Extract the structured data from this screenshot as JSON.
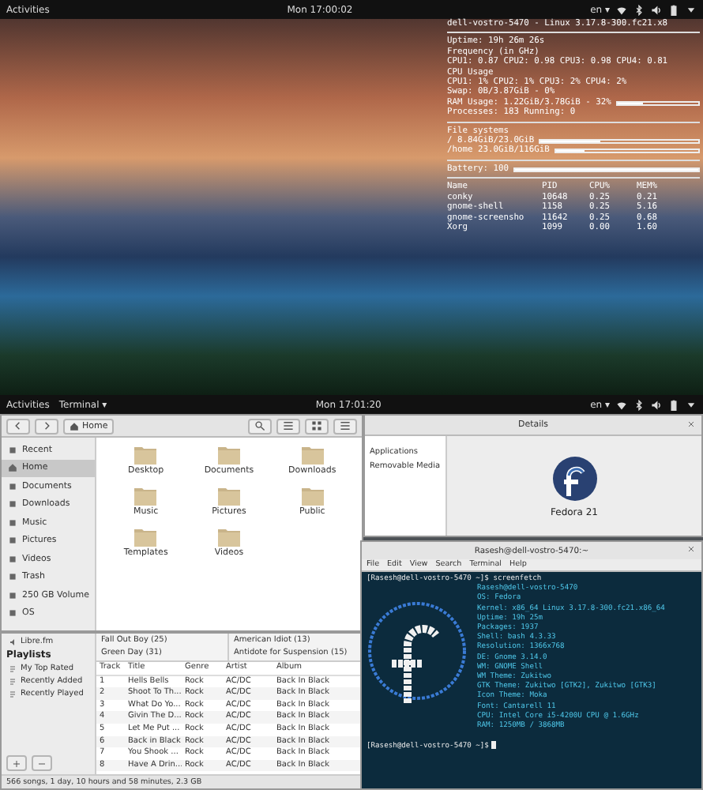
{
  "top_desktop": {
    "top_bar": {
      "activities": "Activities",
      "clock": "Mon 17:00:02",
      "input_source": "en ▾"
    },
    "conky": {
      "header": "dell-vostro-5470 - Linux 3.17.8-300.fc21.x8",
      "lines": [
        {
          "kind": "text",
          "text": "Uptime: 19h 26m 26s"
        },
        {
          "kind": "text",
          "text": "Frequency (in GHz)"
        },
        {
          "kind": "text",
          "text": "CPU1: 0.87 CPU2: 0.98 CPU3: 0.98 CPU4: 0.81"
        },
        {
          "kind": "text",
          "text": "CPU Usage"
        },
        {
          "kind": "text",
          "text": "CPU1: 1% CPU2: 1% CPU3: 2% CPU4: 2%"
        },
        {
          "kind": "text",
          "text": "Swap: 0B/3.87GiB - 0%"
        },
        {
          "kind": "bar",
          "text": "RAM Usage: 1.22GiB/3.78GiB - 32%",
          "level": 0.32
        },
        {
          "kind": "text",
          "text": "Processes: 183 Running: 0"
        },
        {
          "kind": "rule"
        },
        {
          "kind": "text",
          "text": "File systems"
        },
        {
          "kind": "bar",
          "text": "/ 8.84GiB/23.0GiB",
          "level": 0.38
        },
        {
          "kind": "bar",
          "text": "/home 23.0GiB/116GiB",
          "level": 0.2
        },
        {
          "kind": "rule"
        },
        {
          "kind": "bar",
          "text": "Battery: 100",
          "level": 1.0
        }
      ],
      "process_columns": [
        "Name",
        "PID",
        "CPU%",
        "MEM%"
      ],
      "processes": [
        [
          "conky",
          "10648",
          "0.25",
          "0.21"
        ],
        [
          "gnome-shell",
          "1158",
          "0.25",
          "5.16"
        ],
        [
          "gnome-screensho",
          "11642",
          "0.25",
          "0.68"
        ],
        [
          "Xorg",
          "1099",
          "0.00",
          "1.60"
        ]
      ]
    }
  },
  "bottom_desktop": {
    "top_bar": {
      "activities": "Activities",
      "app_menu": "Terminal ▾",
      "clock": "Mon 17:01:20",
      "input_source": "en ▾"
    },
    "files": {
      "path_button": "Home",
      "sidebar": [
        {
          "label": "Recent",
          "selected": false
        },
        {
          "label": "Home",
          "selected": true
        },
        {
          "label": "Documents",
          "selected": false
        },
        {
          "label": "Downloads",
          "selected": false
        },
        {
          "label": "Music",
          "selected": false
        },
        {
          "label": "Pictures",
          "selected": false
        },
        {
          "label": "Videos",
          "selected": false
        },
        {
          "label": "Trash",
          "selected": false
        },
        {
          "label": "250 GB Volume",
          "selected": false
        },
        {
          "label": "OS",
          "selected": false
        }
      ],
      "folders": [
        "Desktop",
        "Documents",
        "Downloads",
        "Music",
        "Pictures",
        "Public",
        "Templates",
        "Videos"
      ]
    },
    "music": {
      "sidebar_item": "Libre.fm",
      "playlists_heading": "Playlists",
      "playlists": [
        "My Top Rated",
        "Recently Added",
        "Recently Played"
      ],
      "artists": [
        "Fall Out Boy (25)",
        "Green Day (31)"
      ],
      "albums": [
        "American Idiot (13)",
        "Antidote for Suspension (15)"
      ],
      "columns": [
        "Track",
        "Title",
        "Genre",
        "Artist",
        "Album"
      ],
      "rows": [
        {
          "playing": false,
          "cells": [
            "1",
            "Hells Bells",
            "Rock",
            "AC/DC",
            "Back In Black"
          ]
        },
        {
          "playing": false,
          "cells": [
            "2",
            "Shoot To Th...",
            "Rock",
            "AC/DC",
            "Back In Black"
          ]
        },
        {
          "playing": false,
          "cells": [
            "3",
            "What Do Yo...",
            "Rock",
            "AC/DC",
            "Back In Black"
          ]
        },
        {
          "playing": false,
          "cells": [
            "4",
            "Givin The D...",
            "Rock",
            "AC/DC",
            "Back In Black"
          ]
        },
        {
          "playing": false,
          "cells": [
            "5",
            "Let Me Put ...",
            "Rock",
            "AC/DC",
            "Back In Black"
          ]
        },
        {
          "playing": false,
          "cells": [
            "6",
            "Back in Black",
            "Rock",
            "AC/DC",
            "Back In Black"
          ]
        },
        {
          "playing": false,
          "cells": [
            "7",
            "You Shook ...",
            "Rock",
            "AC/DC",
            "Back In Black"
          ]
        },
        {
          "playing": false,
          "cells": [
            "8",
            "Have A Drin...",
            "Rock",
            "AC/DC",
            "Back In Black"
          ]
        }
      ],
      "status": "566 songs, 1 day, 10 hours and 58 minutes, 2.3 GB"
    },
    "details": {
      "title": "Details",
      "list": [
        "Applications",
        "Removable Media"
      ],
      "os_name": "Fedora 21"
    },
    "terminal": {
      "title": "Rasesh@dell-vostro-5470:~",
      "menu": [
        "File",
        "Edit",
        "View",
        "Search",
        "Terminal",
        "Help"
      ],
      "command": "[Rasesh@dell-vostro-5470 ~]$ screenfetch",
      "info": [
        "Rasesh@dell-vostro-5470",
        "OS: Fedora",
        "Kernel: x86_64 Linux 3.17.8-300.fc21.x86_64",
        "Uptime: 19h 25m",
        "Packages: 1937",
        "Shell: bash 4.3.33",
        "Resolution: 1366x768",
        "DE: Gnome 3.14.0",
        "WM: GNOME Shell",
        "WM Theme: Zukitwo",
        "GTK Theme: Zukitwo [GTK2], Zukitwo [GTK3]",
        "Icon Theme: Moka",
        "Font: Cantarell 11",
        "CPU: Intel Core i5-4200U CPU @ 1.6GHz",
        "RAM: 1250MB / 3868MB"
      ],
      "prompt": "[Rasesh@dell-vostro-5470 ~]$"
    }
  }
}
